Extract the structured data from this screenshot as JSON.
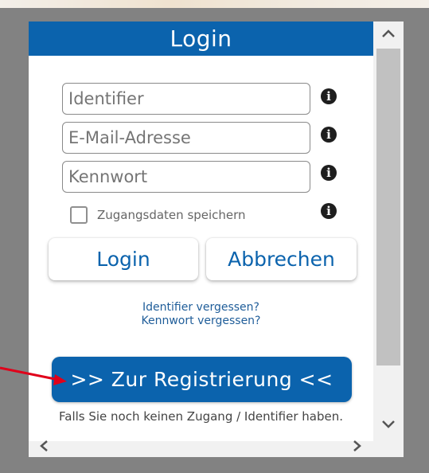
{
  "panel": {
    "title": "Login",
    "fields": {
      "identifier_placeholder": "Identifier",
      "email_placeholder": "E-Mail-Adresse",
      "password_placeholder": "Kennwort",
      "info_glyph": "i"
    },
    "remember_label": "Zugangsdaten speichern",
    "remember_checked": false,
    "login_button": "Login",
    "cancel_button": "Abbrechen",
    "forgot_identifier": "Identifier vergessen?",
    "forgot_password": "Kennwort vergessen?",
    "register_button": ">> Zur Registrierung <<",
    "register_hint": "Falls Sie noch keinen Zugang / Identifier haben."
  },
  "scrollbars": {
    "up_icon": "chevron-up",
    "down_icon": "chevron-down",
    "left_icon": "chevron-left",
    "right_icon": "chevron-right"
  },
  "colors": {
    "brand_blue": "#0b63ad",
    "link_blue": "#1f5d99",
    "annotation_arrow": "#e0001a",
    "frame_gray": "#828282"
  }
}
